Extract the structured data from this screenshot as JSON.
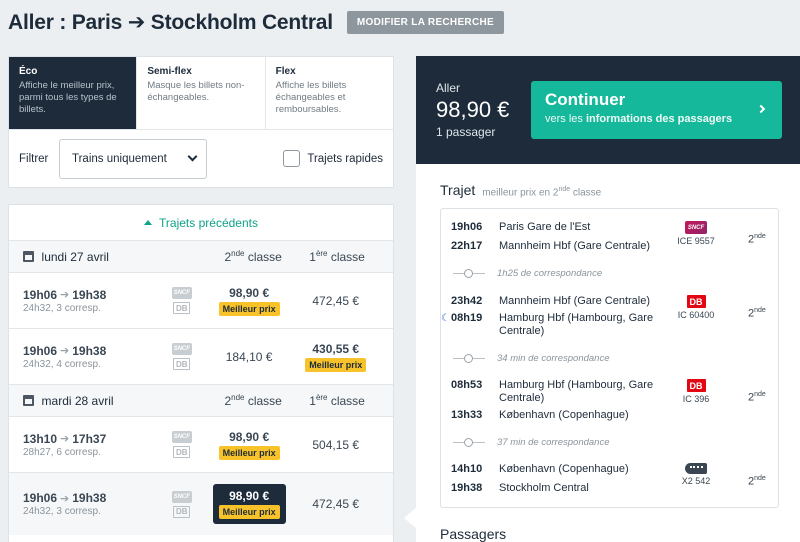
{
  "header": {
    "title": "Aller : Paris ➔ Stockholm Central",
    "modify_label": "MODIFIER LA RECHERCHE"
  },
  "fares": [
    {
      "name": "Éco",
      "desc": "Affiche le meilleur prix, parmi tous les types de billets."
    },
    {
      "name": "Semi-flex",
      "desc": "Masque les billets non-échangeables."
    },
    {
      "name": "Flex",
      "desc": "Affiche les billets échangeables et remboursables."
    }
  ],
  "filter": {
    "label": "Filtrer",
    "value": "Trains uniquement",
    "rapid_label": "Trajets rapides"
  },
  "results": {
    "prev_label": "Trajets précédents",
    "best_label": "Meilleur prix",
    "class2_num": "2",
    "class2_sup": "nde",
    "class2_word": " classe",
    "class1_num": "1",
    "class1_sup": "ère",
    "class1_word": " classe",
    "days": [
      {
        "label": "lundi 27 avril",
        "rows": [
          {
            "dep": "19h06",
            "arr": "19h38",
            "sub": "24h32, 3 corresp.",
            "p2": "98,90 €",
            "p1": "472,45 €"
          },
          {
            "dep": "19h06",
            "arr": "19h38",
            "sub": "24h32, 4 corresp.",
            "p2": "184,10 €",
            "p1": "430,55 €"
          }
        ]
      },
      {
        "label": "mardi 28 avril",
        "rows": [
          {
            "dep": "13h10",
            "arr": "17h37",
            "sub": "28h27, 6 corresp.",
            "p2": "98,90 €",
            "p1": "504,15 €"
          },
          {
            "dep": "19h06",
            "arr": "19h38",
            "sub": "24h32, 3 corresp.",
            "p2": "98,90 €",
            "p1": "472,45 €"
          }
        ]
      }
    ]
  },
  "summary": {
    "direction": "Aller",
    "price": "98,90 €",
    "passengers": "1 passager",
    "continue_title": "Continuer",
    "continue_sub_prefix": "vers les ",
    "continue_sub_bold": "informations des passagers"
  },
  "trajet": {
    "title": "Trajet",
    "note_prefix": "meilleur prix en 2",
    "note_sup": "nde",
    "note_suffix": " classe",
    "class_num": "2",
    "class_sup": "nde",
    "segments": [
      {
        "dep_time": "19h06",
        "dep_station": "Paris Gare de l'Est",
        "arr_time": "22h17",
        "arr_station": "Mannheim Hbf (Gare Centrale)",
        "train": "ICE 9557",
        "logo": "sncf-logo"
      },
      {
        "dep_time": "23h42",
        "dep_station": "Mannheim Hbf (Gare Centrale)",
        "arr_time": "08h19",
        "arr_station": "Hamburg Hbf (Hambourg, Gare Centrale)",
        "train": "IC 60400",
        "logo": "db-logo"
      },
      {
        "dep_time": "08h53",
        "dep_station": "Hamburg Hbf (Hambourg, Gare Centrale)",
        "arr_time": "13h33",
        "arr_station": "København (Copenhague)",
        "train": "IC 396",
        "logo": "db-logo"
      },
      {
        "dep_time": "14h10",
        "dep_station": "København (Copenhague)",
        "arr_time": "19h38",
        "arr_station": "Stockholm Central",
        "train": "X2 542",
        "logo": "train-icon"
      }
    ],
    "connections": [
      "1h25 de correspondance",
      "34 min de correspondance",
      "37 min de correspondance"
    ]
  },
  "passagers_title": "Passagers",
  "colors": {
    "navy": "#1d2b3a",
    "teal": "#15b89b",
    "yellow": "#f7c22a",
    "db_red": "#e30613"
  }
}
